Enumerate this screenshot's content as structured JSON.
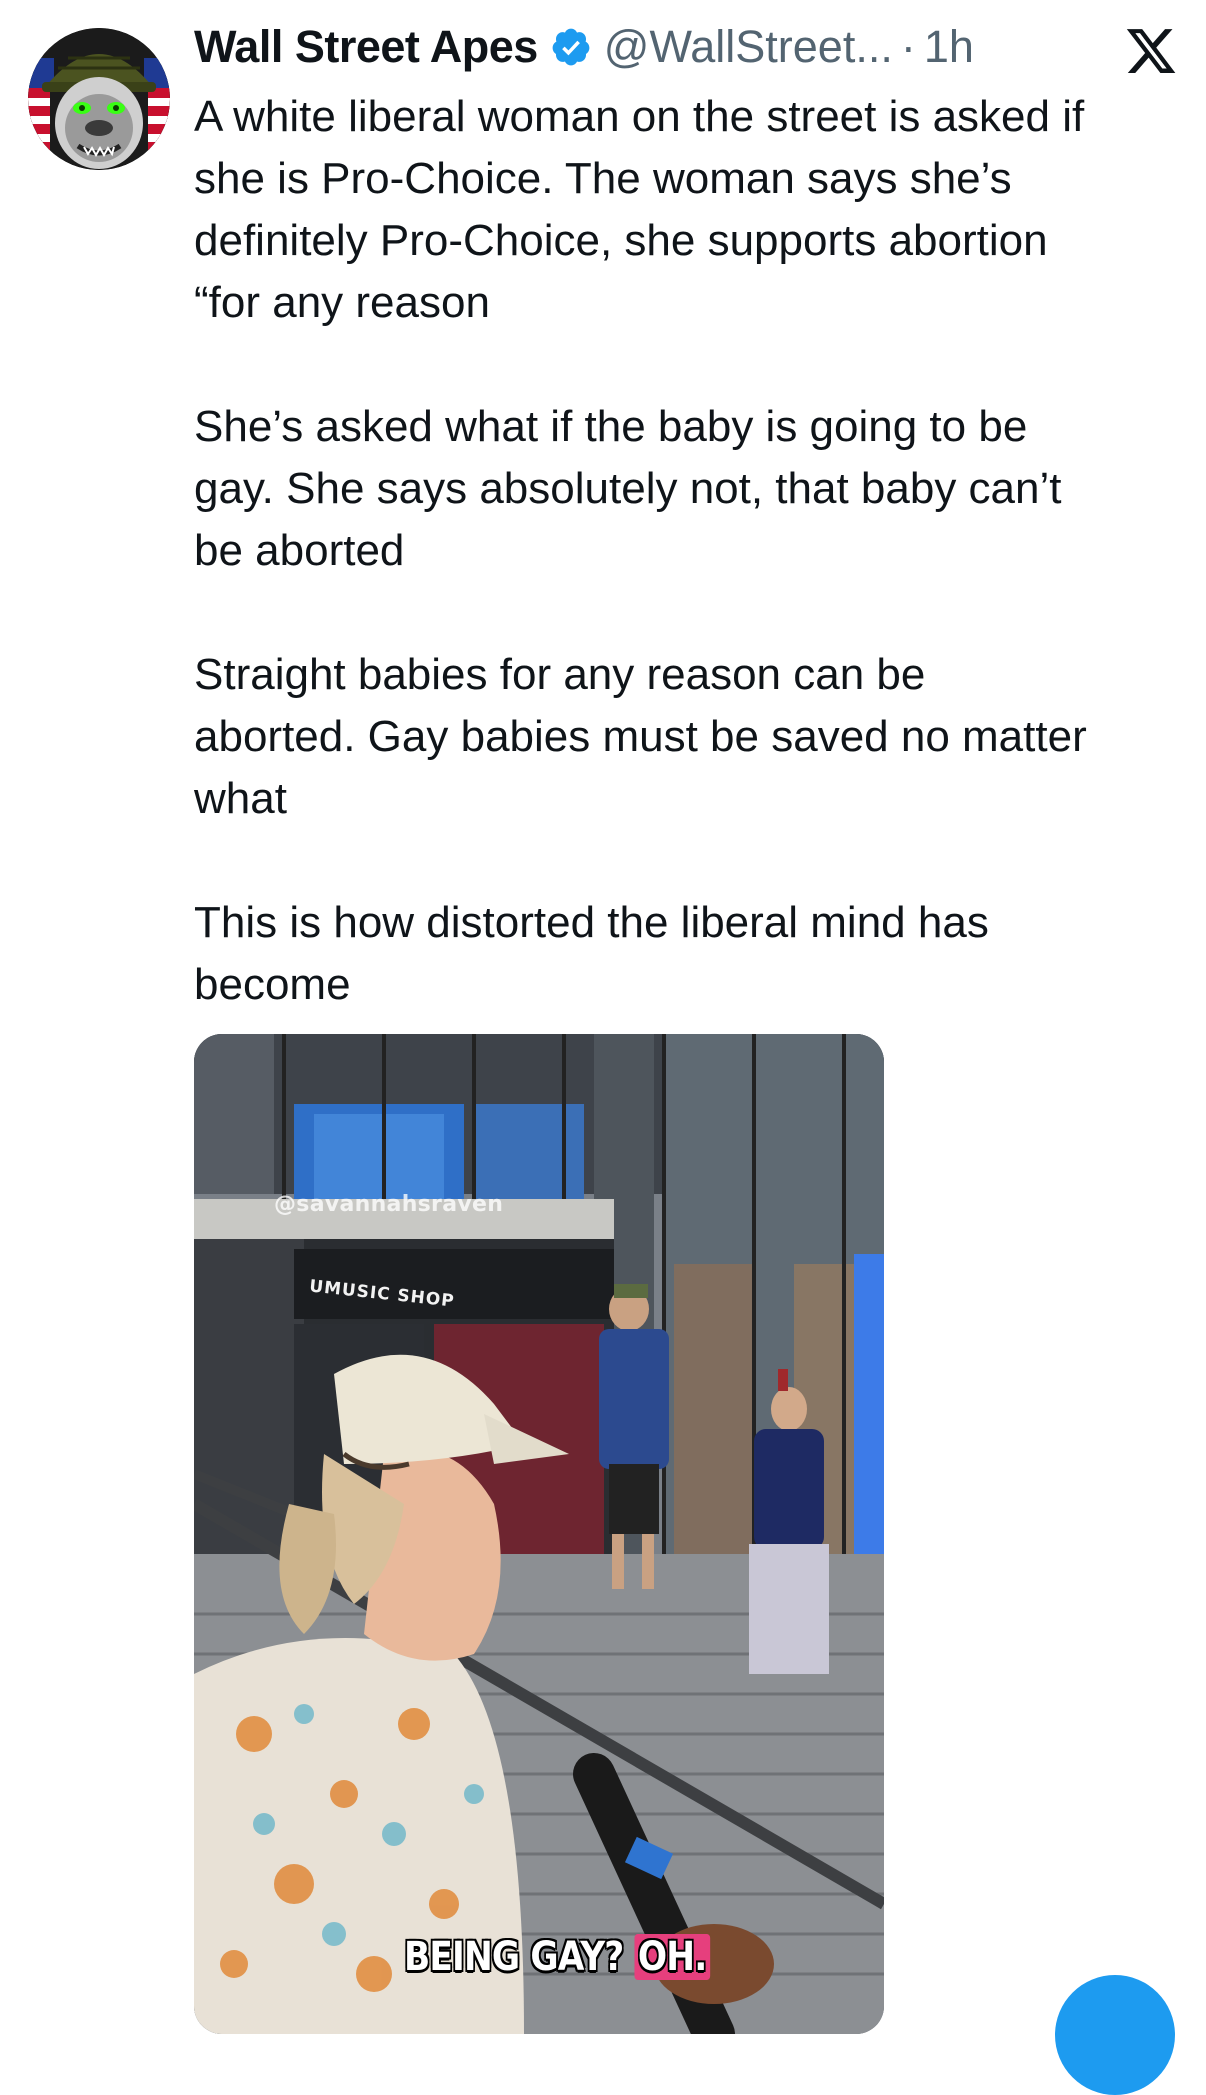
{
  "tweet": {
    "author": {
      "display_name": "Wall Street Apes",
      "verified": true,
      "handle": "@WallStreet...",
      "avatar_icon": "gorilla-soldier-avatar"
    },
    "separator": "·",
    "time": "1h",
    "platform_icon": "x-logo-icon",
    "paragraphs": [
      {
        "lines": [
          "A white liberal woman on the street is asked if",
          "she is Pro-Choice. The woman says she’s",
          "definitely Pro-Choice, she supports abortion",
          "“for any reason"
        ]
      },
      {
        "lines": [
          "She’s asked what if the baby is going to be",
          "gay. She says absolutely not, that baby can’t",
          "be aborted"
        ]
      },
      {
        "lines": [
          "Straight babies for any reason can be",
          "aborted. Gay babies must be saved no matter",
          "what"
        ]
      },
      {
        "lines": [
          "This is how distorted the liberal mind has",
          "become"
        ]
      }
    ],
    "media": {
      "type": "video",
      "watermark": "@savannahsraven",
      "shop_sign": "UMUSIC SHOP",
      "caption_part1": "BEING GAY?",
      "caption_part2": "OH.",
      "caption_highlight_color": "#e63f7d"
    }
  },
  "colors": {
    "text_primary": "#0f1419",
    "text_secondary": "#536471",
    "verified_blue": "#1d9bf0",
    "background": "#ffffff"
  }
}
